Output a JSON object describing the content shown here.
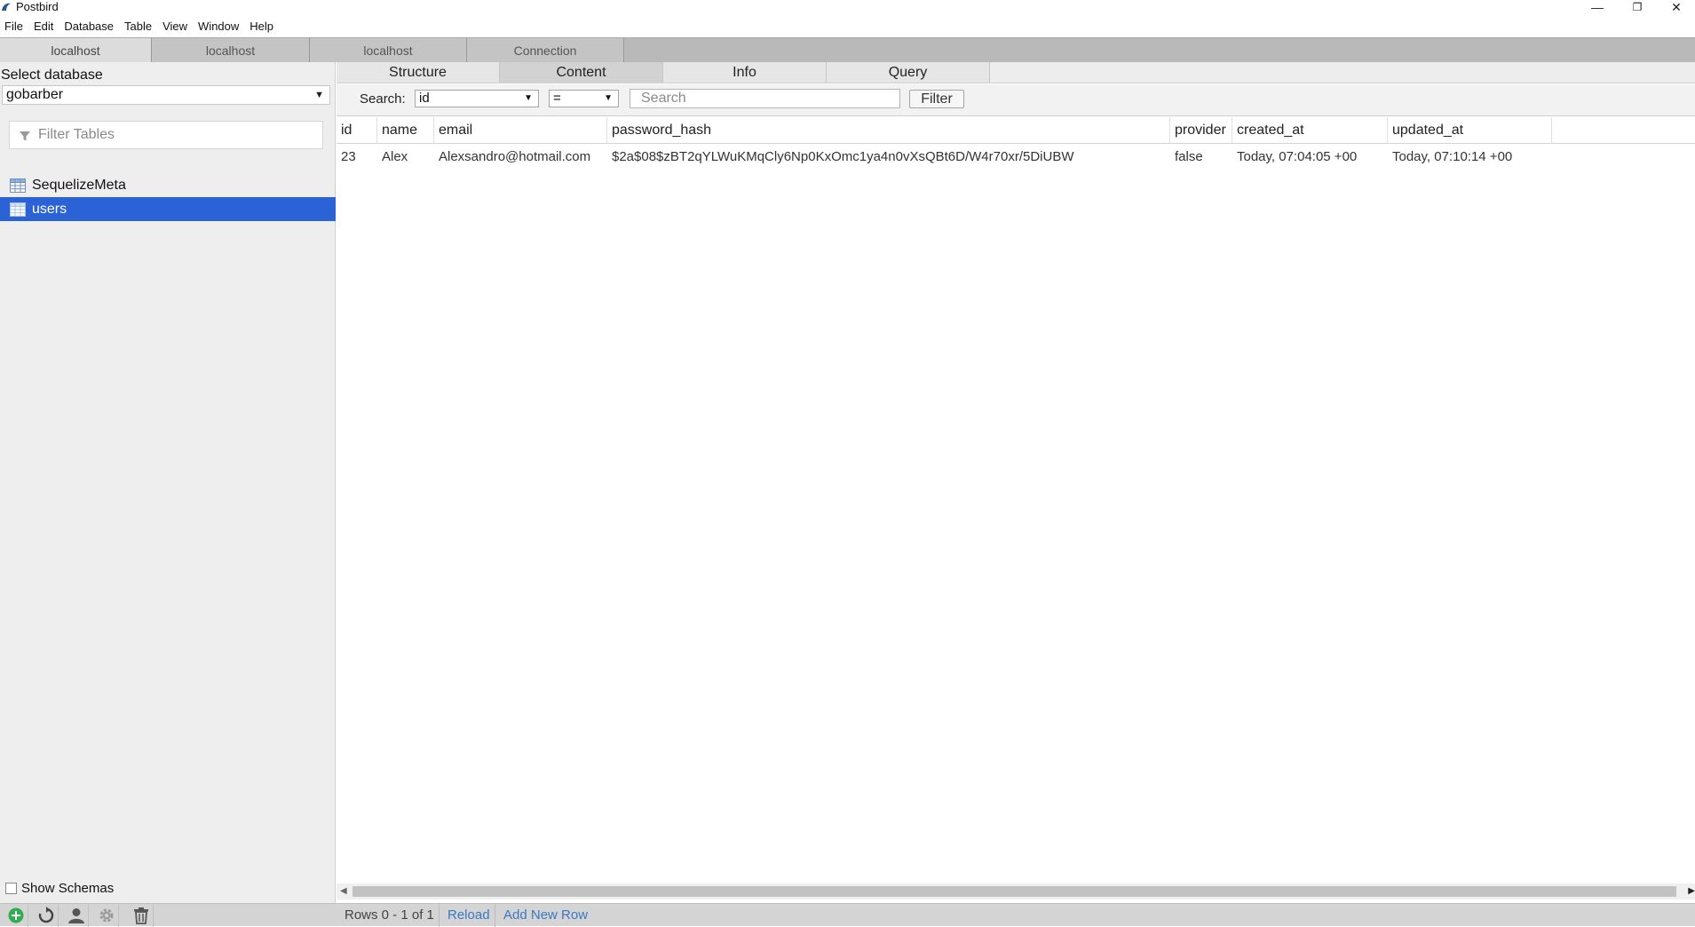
{
  "window": {
    "title": "Postbird",
    "controls": {
      "minimize": "—",
      "restore": "❐",
      "close": "✕"
    }
  },
  "menu": [
    "File",
    "Edit",
    "Database",
    "Table",
    "View",
    "Window",
    "Help"
  ],
  "connection_tabs": [
    {
      "label": "localhost",
      "active": true
    },
    {
      "label": "localhost",
      "active": false
    },
    {
      "label": "localhost",
      "active": false
    },
    {
      "label": "Connection",
      "active": false
    }
  ],
  "sidebar": {
    "select_database_label": "Select database",
    "database": "gobarber",
    "filter_placeholder": "Filter Tables",
    "tables": [
      {
        "name": "SequelizeMeta",
        "selected": false
      },
      {
        "name": "users",
        "selected": true
      }
    ],
    "show_schemas_label": "Show Schemas"
  },
  "content_tabs": [
    {
      "label": "Structure",
      "active": false
    },
    {
      "label": "Content",
      "active": true
    },
    {
      "label": "Info",
      "active": false
    },
    {
      "label": "Query",
      "active": false
    }
  ],
  "search": {
    "label": "Search:",
    "column": "id",
    "operator": "=",
    "placeholder": "Search",
    "filter_button": "Filter"
  },
  "grid": {
    "columns": [
      "id",
      "name",
      "email",
      "password_hash",
      "provider",
      "created_at",
      "updated_at"
    ],
    "rows": [
      [
        "23",
        "Alex",
        "Alexsandro@hotmail.com",
        "$2a$08$zBT2qYLWuKMqCly6Np0KxOmc1ya4n0vXsQBt6D/W4r70xr/5DiUBW",
        "false",
        "Today, 07:04:05 +00",
        "Today, 07:10:14 +00"
      ]
    ]
  },
  "footer": {
    "rows_info": "Rows 0 - 1 of 1",
    "reload": "Reload",
    "add_row": "Add New Row"
  },
  "colors": {
    "selection": "#2b62d6",
    "link": "#3a78c4",
    "add_button": "#2eae4f"
  }
}
